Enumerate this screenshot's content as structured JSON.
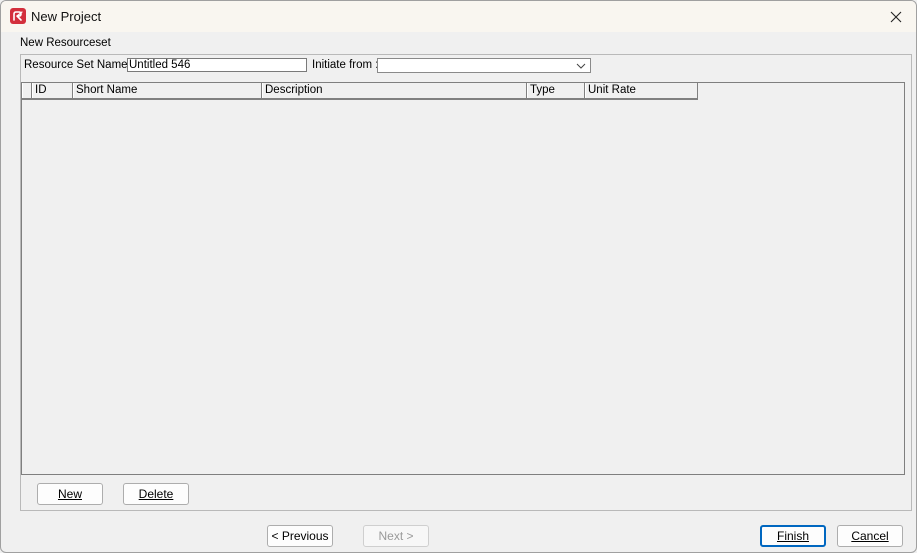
{
  "window": {
    "title": "New Project",
    "icon": "app-logo-icon",
    "close_icon": "close-icon"
  },
  "section": {
    "label": "New Resourceset"
  },
  "form": {
    "resource_set_name_label": "Resource Set Name:",
    "resource_set_name_value": "Untitled 546",
    "initiate_from_label": "Initiate from :",
    "initiate_from_value": ""
  },
  "grid": {
    "columns": [
      "ID",
      "Short Name",
      "Description",
      "Type",
      "Unit Rate"
    ],
    "rows": []
  },
  "grid_buttons": {
    "new_label": "New",
    "delete_label": "Delete"
  },
  "wizard_buttons": {
    "previous_label": "< Previous",
    "next_label": "Next >",
    "finish_label": "Finish",
    "cancel_label": "Cancel"
  },
  "colors": {
    "app_icon": "#d32f3c",
    "default_button_border": "#0067c0",
    "titlebar": "#f9f6f0"
  }
}
